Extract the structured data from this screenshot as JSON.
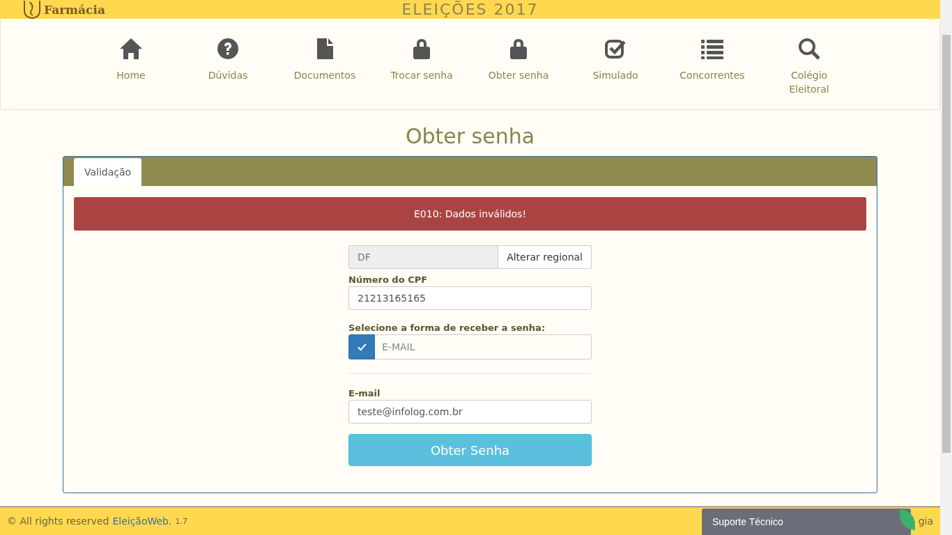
{
  "header": {
    "logo_text": "Farmácia",
    "title": "ELEIÇÕES 2017"
  },
  "nav": [
    {
      "label": "Home",
      "kind": "home"
    },
    {
      "label": "Dúvidas",
      "kind": "help"
    },
    {
      "label": "Documentos",
      "kind": "documents"
    },
    {
      "label": "Trocar senha",
      "kind": "password"
    },
    {
      "label": "Obter senha",
      "kind": "password"
    },
    {
      "label": "Simulado",
      "kind": "test"
    },
    {
      "label": "Concorrentes",
      "kind": "candidates"
    },
    {
      "label": "Colégio Eleitoral",
      "kind": "lookup"
    }
  ],
  "page_title": "Obter senha",
  "tabs": [
    {
      "label": "Validação",
      "selected": true
    }
  ],
  "alert": "E010: Dados inválidos!",
  "form": {
    "regional": "DF",
    "change_regional": "Alterar regional",
    "cpf_label": "Número do CPF",
    "cpf_value": "21213165165",
    "method_label": "Selecione a forma de receber a senha:",
    "method": {
      "label": "E-MAIL",
      "checked": true
    },
    "email_label": "E-mail",
    "email_value": "teste@infolog.com.br",
    "submit": "Obter Senha"
  },
  "footer": {
    "copyright": "© All rights reserved",
    "brand": "EleiçãoWeb.",
    "version": "1.7",
    "right_text": "gia"
  },
  "support_widget": "Suporte Técnico"
}
